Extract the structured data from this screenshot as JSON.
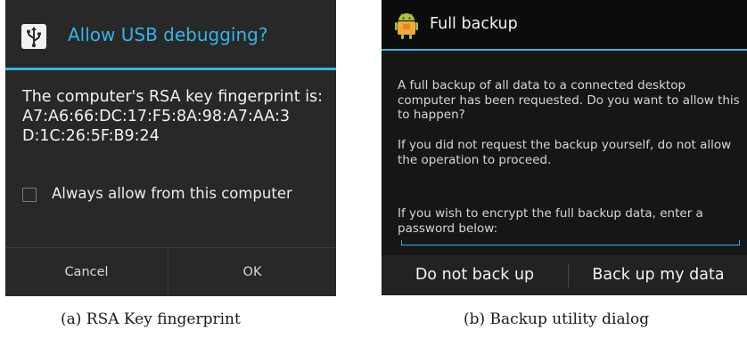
{
  "usb_dialog": {
    "title": "Allow USB debugging?",
    "message": "The computer's RSA key fingerprint is:",
    "fingerprint_line1": "A7:A6:66:DC:17:F5:8A:98:A7:AA:3",
    "fingerprint_line2": "D:1C:26:5F:B9:24",
    "checkbox_label": "Always allow from this computer",
    "checkbox_checked": false,
    "cancel_label": "Cancel",
    "ok_label": "OK",
    "title_icon": "usb-icon",
    "accent_color": "#33b5e5"
  },
  "backup_dialog": {
    "title": "Full backup",
    "title_icon": "android-icon",
    "paragraph1": "A full backup of all data to a connected desktop computer has been requested. Do you want to allow this to happen?",
    "paragraph2": "If you did not request the backup yourself, do not allow the operation to proceed.",
    "paragraph3": "If you wish to encrypt the full backup data, enter a password below:",
    "password_value": "",
    "negative_label": "Do not back up",
    "positive_label": "Back up my data",
    "accent_color": "#33b5e5"
  },
  "captions": {
    "a": "(a) RSA Key fingerprint",
    "b": "(b) Backup utility dialog"
  }
}
